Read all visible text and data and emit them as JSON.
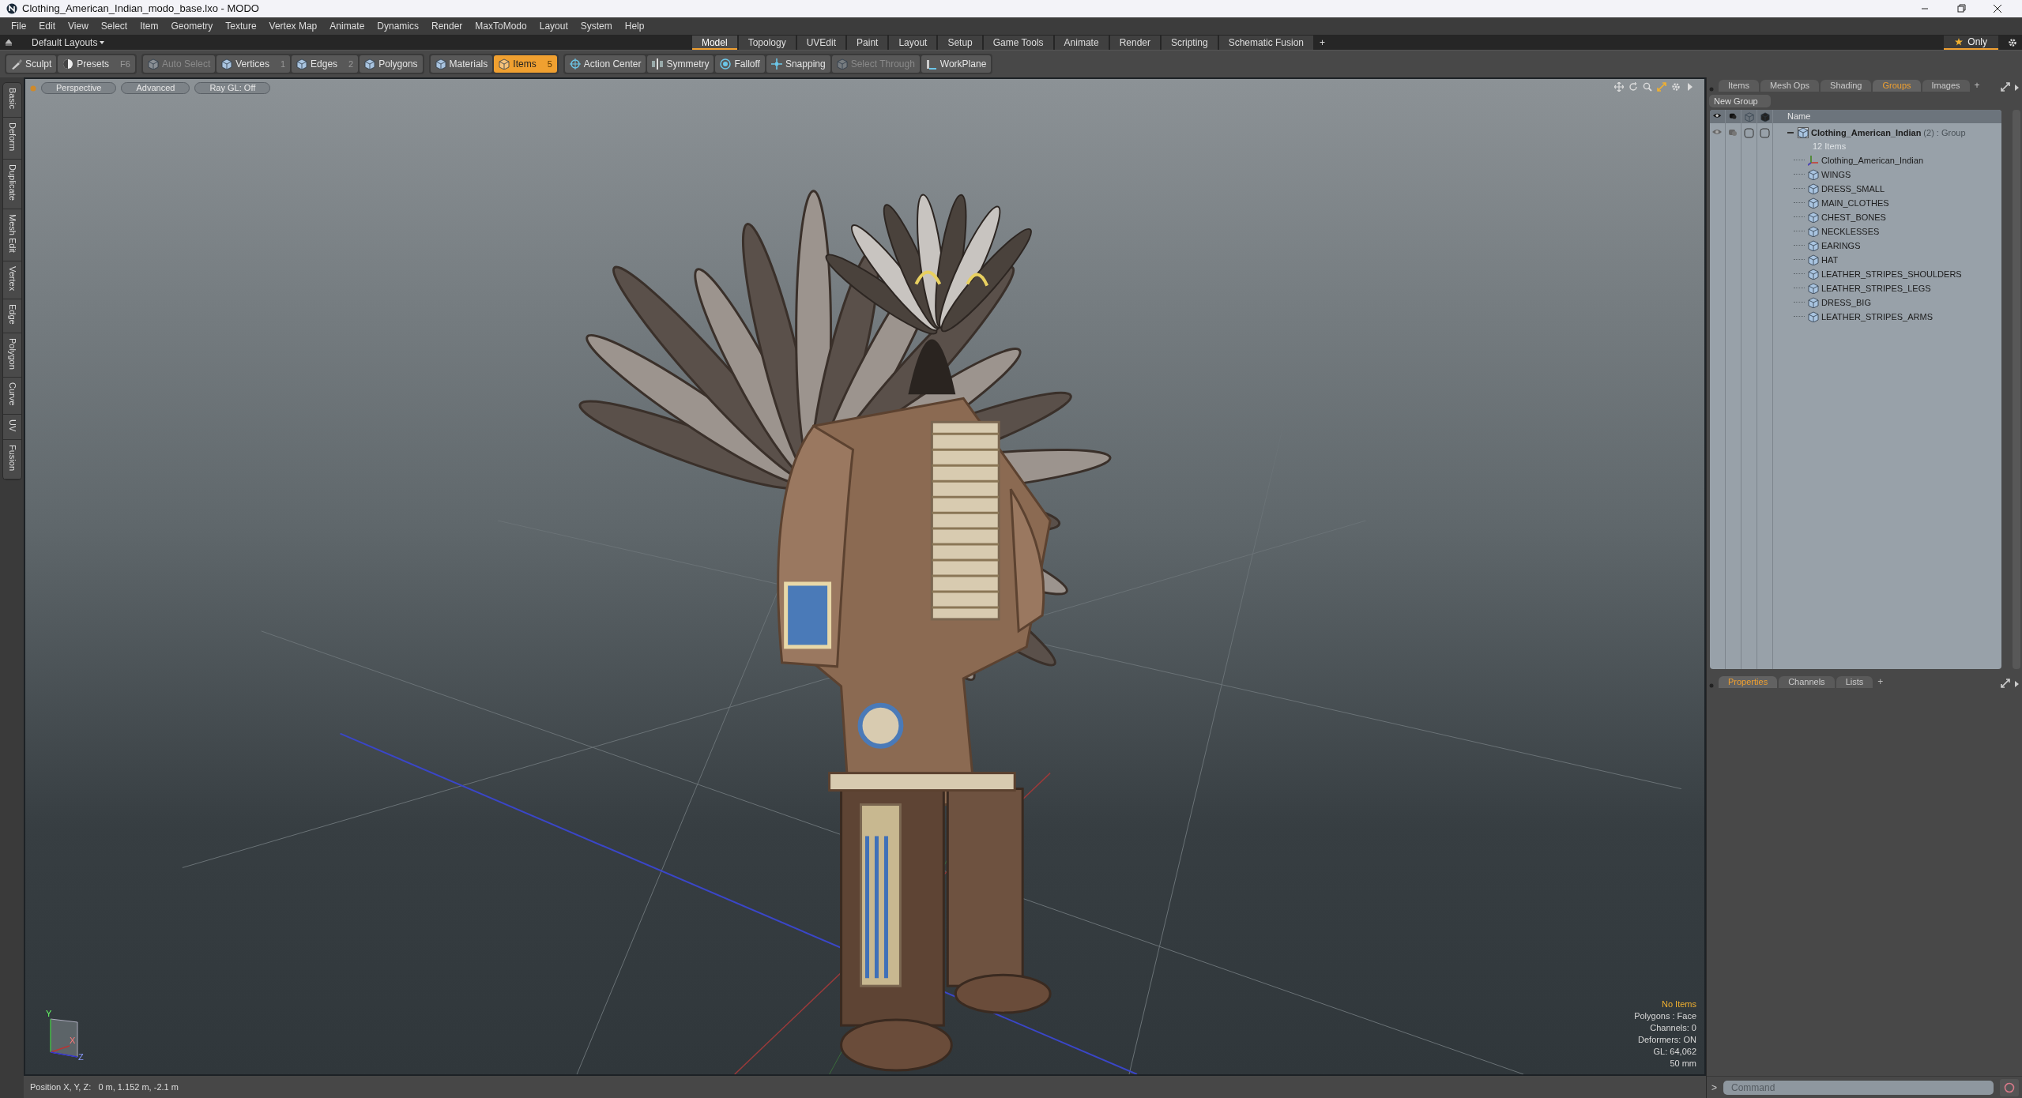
{
  "window": {
    "title": "Clothing_American_Indian_modo_base.lxo - MODO"
  },
  "menu": [
    "File",
    "Edit",
    "View",
    "Select",
    "Item",
    "Geometry",
    "Texture",
    "Vertex Map",
    "Animate",
    "Dynamics",
    "Render",
    "MaxToModo",
    "Layout",
    "System",
    "Help"
  ],
  "layout_bar": {
    "layouts_dropdown": "Default Layouts",
    "tabs": [
      {
        "label": "Model",
        "selected": true
      },
      {
        "label": "Topology",
        "selected": false
      },
      {
        "label": "UVEdit",
        "selected": false
      },
      {
        "label": "Paint",
        "selected": false
      },
      {
        "label": "Layout",
        "selected": false
      },
      {
        "label": "Setup",
        "selected": false
      },
      {
        "label": "Game Tools",
        "selected": false
      },
      {
        "label": "Animate",
        "selected": false
      },
      {
        "label": "Render",
        "selected": false
      },
      {
        "label": "Scripting",
        "selected": false
      },
      {
        "label": "Schematic Fusion",
        "selected": false
      }
    ],
    "add_tab": "+",
    "only_button": "Only"
  },
  "toolbar": [
    {
      "items": [
        {
          "label": "Sculpt",
          "selected": false,
          "disabled": false
        },
        {
          "label": "Presets",
          "shortcut": "F6",
          "selected": false,
          "disabled": false
        }
      ]
    },
    {
      "items": [
        {
          "label": "Auto Select",
          "selected": false,
          "disabled": true
        },
        {
          "label": "Vertices",
          "shortcut": "1",
          "selected": false,
          "disabled": false
        },
        {
          "label": "Edges",
          "shortcut": "2",
          "selected": false,
          "disabled": false
        },
        {
          "label": "Polygons",
          "selected": false,
          "disabled": false
        }
      ]
    },
    {
      "items": [
        {
          "label": "Materials",
          "selected": false,
          "disabled": false
        },
        {
          "label": "Items",
          "shortcut": "5",
          "selected": true,
          "disabled": false
        }
      ]
    },
    {
      "items": [
        {
          "label": "Action Center",
          "selected": false,
          "disabled": false
        },
        {
          "label": "Symmetry",
          "selected": false,
          "disabled": false
        },
        {
          "label": "Falloff",
          "selected": false,
          "disabled": false
        },
        {
          "label": "Snapping",
          "selected": false,
          "disabled": false
        },
        {
          "label": "Select Through",
          "selected": false,
          "disabled": true
        },
        {
          "label": "WorkPlane",
          "selected": false,
          "disabled": false
        }
      ]
    }
  ],
  "sidebar": {
    "tabs": [
      "Basic",
      "Deform",
      "Duplicate",
      "Mesh Edit",
      "Vertex",
      "Edge",
      "Polygon",
      "Curve",
      "UV",
      "Fusion"
    ]
  },
  "viewport": {
    "tabs": [
      "Perspective",
      "Advanced",
      "Ray GL: Off"
    ],
    "axis_labels": [
      "Y",
      "X",
      "Z"
    ],
    "info": [
      {
        "text": "No Items",
        "kind": "highlight"
      },
      {
        "text": "Polygons : Face",
        "kind": "plain"
      },
      {
        "text": "Channels: 0",
        "kind": "plain"
      },
      {
        "text": "Deformers: ON",
        "kind": "plain"
      },
      {
        "text": "GL: 64,062",
        "kind": "plain"
      },
      {
        "text": "50 mm",
        "kind": "plain"
      }
    ]
  },
  "status_bar": {
    "position": "Position X, Y, Z:   0 m, 1.152 m, -2.1 m"
  },
  "groups_panel": {
    "tabs": [
      {
        "label": "Items",
        "selected": false
      },
      {
        "label": "Mesh Ops",
        "selected": false
      },
      {
        "label": "Shading",
        "selected": false
      },
      {
        "label": "Groups",
        "selected": true
      },
      {
        "label": "Images",
        "selected": false
      }
    ],
    "add_tab": "+",
    "new_group_button": "New Group",
    "name_column": "Name",
    "group": {
      "name": "Clothing_American_Indian",
      "count": "(2)",
      "type": ": Group",
      "subtitle": "12 Items",
      "expanded": true,
      "children": [
        {
          "name": "Clothing_American_Indian",
          "kind": "locator"
        },
        {
          "name": "WINGS",
          "kind": "mesh"
        },
        {
          "name": "DRESS_SMALL",
          "kind": "mesh"
        },
        {
          "name": "MAIN_CLOTHES",
          "kind": "mesh"
        },
        {
          "name": "CHEST_BONES",
          "kind": "mesh"
        },
        {
          "name": "NECKLESSES",
          "kind": "mesh"
        },
        {
          "name": "EARINGS",
          "kind": "mesh"
        },
        {
          "name": "HAT",
          "kind": "mesh"
        },
        {
          "name": "LEATHER_STRIPES_SHOULDERS",
          "kind": "mesh"
        },
        {
          "name": "LEATHER_STRIPES_LEGS",
          "kind": "mesh"
        },
        {
          "name": "DRESS_BIG",
          "kind": "mesh"
        },
        {
          "name": "LEATHER_STRIPES_ARMS",
          "kind": "mesh"
        }
      ]
    }
  },
  "properties_panel": {
    "tabs": [
      {
        "label": "Properties",
        "selected": true
      },
      {
        "label": "Channels",
        "selected": false
      },
      {
        "label": "Lists",
        "selected": false
      }
    ],
    "add_tab": "+"
  },
  "command_line": {
    "prompt": ">",
    "placeholder": "Command"
  }
}
